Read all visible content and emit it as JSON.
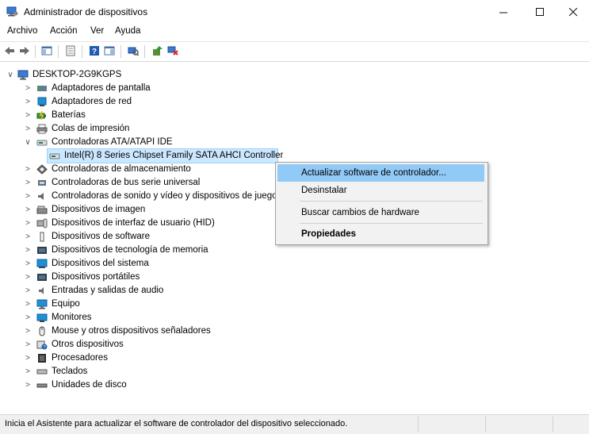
{
  "window": {
    "title": "Administrador de dispositivos"
  },
  "menu": [
    "Archivo",
    "Acción",
    "Ver",
    "Ayuda"
  ],
  "tree": {
    "root": "DESKTOP-2G9KGPS",
    "items": [
      {
        "label": "Adaptadores de pantalla",
        "icon": "display-adapter-icon",
        "expanded": false
      },
      {
        "label": "Adaptadores de red",
        "icon": "network-adapter-icon",
        "expanded": false
      },
      {
        "label": "Baterías",
        "icon": "battery-icon",
        "expanded": false
      },
      {
        "label": "Colas de impresión",
        "icon": "print-queue-icon",
        "expanded": false
      },
      {
        "label": "Controladoras ATA/ATAPI IDE",
        "icon": "ide-controller-icon",
        "expanded": true
      },
      {
        "label": "Intel(R) 8 Series Chipset Family SATA AHCI Controller",
        "icon": "ide-controller-icon",
        "child": true,
        "selected": true
      },
      {
        "label": "Controladoras de almacenamiento",
        "icon": "storage-controller-icon",
        "expanded": false
      },
      {
        "label": "Controladoras de bus serie universal",
        "icon": "usb-icon",
        "expanded": false
      },
      {
        "label": "Controladoras de sonido y vídeo y dispositivos de juego",
        "icon": "sound-icon",
        "expanded": false
      },
      {
        "label": "Dispositivos de imagen",
        "icon": "imaging-icon",
        "expanded": false
      },
      {
        "label": "Dispositivos de interfaz de usuario (HID)",
        "icon": "hid-icon",
        "expanded": false
      },
      {
        "label": "Dispositivos de software",
        "icon": "software-device-icon",
        "expanded": false
      },
      {
        "label": "Dispositivos de tecnología de memoria",
        "icon": "memory-tech-icon",
        "expanded": false
      },
      {
        "label": "Dispositivos del sistema",
        "icon": "system-device-icon",
        "expanded": false
      },
      {
        "label": "Dispositivos portátiles",
        "icon": "portable-device-icon",
        "expanded": false
      },
      {
        "label": "Entradas y salidas de audio",
        "icon": "audio-io-icon",
        "expanded": false
      },
      {
        "label": "Equipo",
        "icon": "computer-icon",
        "expanded": false
      },
      {
        "label": "Monitores",
        "icon": "monitor-icon",
        "expanded": false
      },
      {
        "label": "Mouse y otros dispositivos señaladores",
        "icon": "mouse-icon",
        "expanded": false
      },
      {
        "label": "Otros dispositivos",
        "icon": "unknown-device-icon",
        "expanded": false
      },
      {
        "label": "Procesadores",
        "icon": "processor-icon",
        "expanded": false
      },
      {
        "label": "Teclados",
        "icon": "keyboard-icon",
        "expanded": false
      },
      {
        "label": "Unidades de disco",
        "icon": "disk-drive-icon",
        "expanded": false
      }
    ]
  },
  "context_menu": {
    "update": "Actualizar software de controlador...",
    "uninstall": "Desinstalar",
    "scan": "Buscar cambios de hardware",
    "properties": "Propiedades"
  },
  "status": {
    "text": "Inicia el Asistente para actualizar el software de controlador del dispositivo seleccionado."
  },
  "colors": {
    "selection": "#cce8ff",
    "menu_highlight": "#91c9f7",
    "accent": "#1e6fd0"
  }
}
